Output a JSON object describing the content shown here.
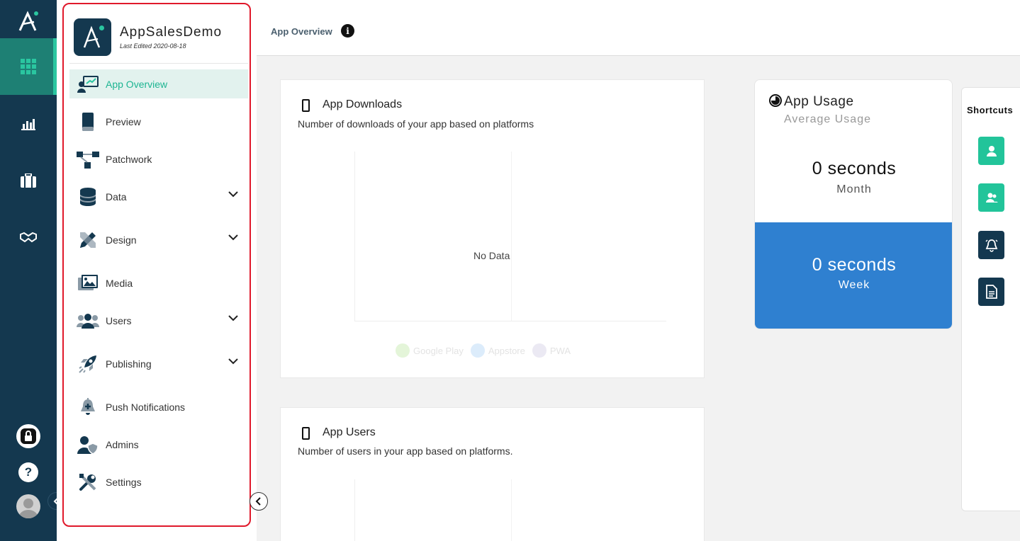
{
  "app": {
    "name": "AppSalesDemo",
    "last_edited": "Last Edited 2020-08-18"
  },
  "sidebar": {
    "items": [
      {
        "label": "App Overview",
        "icon": "presentation-icon",
        "active": true,
        "expandable": false
      },
      {
        "label": "Preview",
        "icon": "mobile-icon",
        "active": false,
        "expandable": false
      },
      {
        "label": "Patchwork",
        "icon": "sitemap-icon",
        "active": false,
        "expandable": false
      },
      {
        "label": "Data",
        "icon": "database-icon",
        "active": false,
        "expandable": true
      },
      {
        "label": "Design",
        "icon": "pencil-ruler-icon",
        "active": false,
        "expandable": true
      },
      {
        "label": "Media",
        "icon": "images-icon",
        "active": false,
        "expandable": false
      },
      {
        "label": "Users",
        "icon": "users-icon",
        "active": false,
        "expandable": true
      },
      {
        "label": "Publishing",
        "icon": "rocket-icon",
        "active": false,
        "expandable": true
      },
      {
        "label": "Push Notifications",
        "icon": "bell-plus-icon",
        "active": false,
        "expandable": false
      },
      {
        "label": "Admins",
        "icon": "user-shield-icon",
        "active": false,
        "expandable": false
      },
      {
        "label": "Settings",
        "icon": "tools-icon",
        "active": false,
        "expandable": false
      }
    ]
  },
  "header": {
    "title": "App Overview",
    "info_glyph": "i"
  },
  "rail": {
    "help_glyph": "?"
  },
  "downloads_card": {
    "title": "App Downloads",
    "description": "Number of downloads of your app based on platforms",
    "empty_text": "No Data",
    "legend": [
      {
        "label": "Google Play",
        "color": "#e4f5d9"
      },
      {
        "label": "Appstore",
        "color": "#dcecfb"
      },
      {
        "label": "PWA",
        "color": "#ebe9f3"
      }
    ]
  },
  "users_card": {
    "title": "App Users",
    "description": "Number of users in your app based on platforms."
  },
  "usage": {
    "title": "App Usage",
    "subtitle": "Average Usage",
    "month_value": "0 seconds",
    "month_label": "Month",
    "week_value": "0 seconds",
    "week_label": "Week"
  },
  "shortcuts": {
    "title": "Shortcuts",
    "buttons": [
      {
        "icon": "user-icon",
        "color": "#22c49a"
      },
      {
        "icon": "users-icon",
        "color": "#22c49a"
      },
      {
        "icon": "bell-icon",
        "color": "#14384f"
      },
      {
        "icon": "document-icon",
        "color": "#14384f"
      }
    ]
  },
  "colors": {
    "rail": "#14384f",
    "accent": "#1db592",
    "week_bg": "#2f80d0",
    "highlight_frame": "#e0192b"
  }
}
